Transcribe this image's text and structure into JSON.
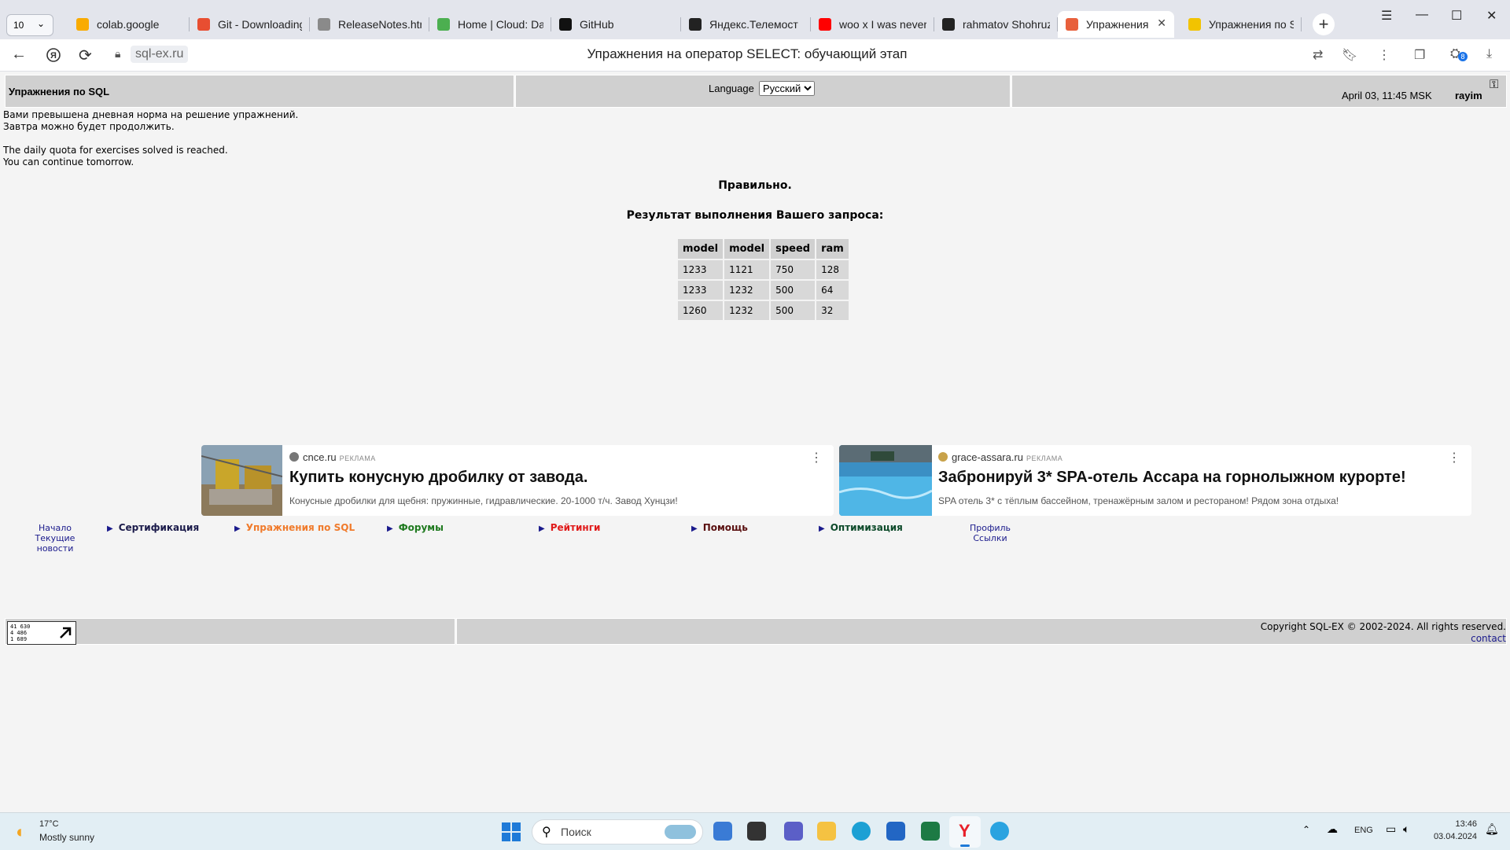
{
  "browser": {
    "tab_count": "10",
    "tabs": [
      {
        "title": "colab.google",
        "icon": "colab-icon",
        "color": "#f9ab00"
      },
      {
        "title": "Git - Downloading P",
        "icon": "git-icon",
        "color": "#e84e31"
      },
      {
        "title": "ReleaseNotes.html",
        "icon": "file-icon",
        "color": "#8a8a8a"
      },
      {
        "title": "Home | Cloud: Data",
        "icon": "cloud-icon",
        "color": "#4caf50"
      },
      {
        "title": "GitHub",
        "icon": "github-icon",
        "color": "#111111"
      },
      {
        "title": "Яндекс.Телемост",
        "icon": "telemost-icon",
        "color": "#222222"
      },
      {
        "title": "woo x I was never t",
        "icon": "youtube-icon",
        "color": "#ff0000"
      },
      {
        "title": "rahmatov Shohruz",
        "icon": "openai-icon",
        "color": "#222222"
      },
      {
        "title": "Упражнения на",
        "icon": "sqlex-icon",
        "color": "#e8603c",
        "active": true
      },
      {
        "title": "Упражнения по SQ",
        "icon": "sql-icon",
        "color": "#f2c300"
      }
    ],
    "url_domain": "sql-ex.ru",
    "page_title": "Упражнения на оператор SELECT: обучающий этап",
    "extension_badge": "8"
  },
  "header": {
    "site_title": "Упражнения по SQL",
    "language_label": "Language",
    "language_value": "Русский",
    "datetime": "April 03, 11:45 MSK",
    "username": "rayim"
  },
  "messages": {
    "ru_line1": "Вами превышена дневная норма на решение упражнений.",
    "ru_line2": "Завтра можно будет продолжить.",
    "en_line1": "The daily quota for exercises solved is reached.",
    "en_line2": "You can continue tomorrow."
  },
  "result": {
    "status": "Правильно.",
    "caption": "Результат выполнения Вашего запроса:",
    "columns": [
      "model",
      "model",
      "speed",
      "ram"
    ],
    "rows": [
      [
        "1233",
        "1121",
        "750",
        "128"
      ],
      [
        "1233",
        "1232",
        "500",
        "64"
      ],
      [
        "1260",
        "1232",
        "500",
        "32"
      ]
    ]
  },
  "ads": [
    {
      "source": "cnce.ru",
      "tag": "РЕКЛАМА",
      "headline": "Купить конусную дробилку от завода.",
      "description": "Конусные дробилки для щебня: пружинные, гидравлические. 20-1000 т/ч. Завод Хунцзи!"
    },
    {
      "source": "grace-assara.ru",
      "tag": "РЕКЛАМА",
      "headline": "Забронируй 3* SPA-отель Ассара на горнолыжном курорте!",
      "description": "SPA отель 3* с тёплым бассейном, тренажёрным залом и рестораном! Рядом зона отдыха!"
    }
  ],
  "nav": {
    "home": "Начало",
    "news": "Текущие новости",
    "links": [
      {
        "label": "Сертификация",
        "color": "#1a1a4a"
      },
      {
        "label": "Упражнения по SQL",
        "color": "#f07b2c"
      },
      {
        "label": "Форумы",
        "color": "#1f7a1f"
      },
      {
        "label": "Рейтинги",
        "color": "#e01b1b"
      },
      {
        "label": "Помощь",
        "color": "#5a1010"
      },
      {
        "label": "Оптимизация",
        "color": "#0d4a2a"
      }
    ],
    "profile": "Профиль",
    "links_label": "Ссылки"
  },
  "counter": {
    "line1": "41 630",
    "line2": "4 486",
    "line3": "1 689"
  },
  "footer": {
    "copyright": "Copyright SQL-EX © 2002-2024. All rights reserved.",
    "contact": "contact"
  },
  "taskbar": {
    "temperature": "17°C",
    "weather": "Mostly sunny",
    "search_placeholder": "Поиск",
    "lang": "ENG",
    "time": "13:46",
    "date": "03.04.2024"
  }
}
